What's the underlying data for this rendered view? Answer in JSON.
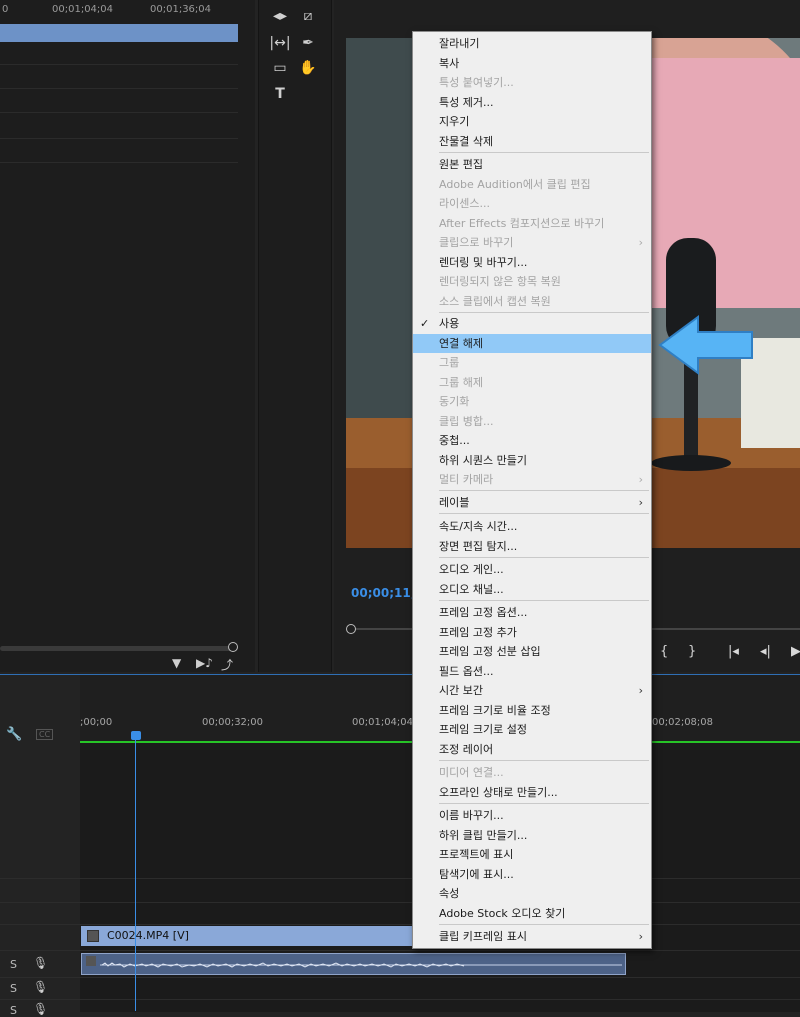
{
  "source_panel": {
    "timecodes": [
      "0",
      "00;01;04;04",
      "00;01;36;04"
    ]
  },
  "program_panel": {
    "timecode": "00;00;11;5"
  },
  "timeline": {
    "ruler": [
      ";00;00",
      "00;00;32;00",
      "00;01;04;04",
      "00;02;08;08"
    ],
    "video_clip_name": "C0024.MP4 [V]",
    "track_label_s": "S",
    "cc_label": "CC"
  },
  "context_menu": {
    "items": [
      {
        "label": "잘라내기",
        "enabled": true
      },
      {
        "label": "복사",
        "enabled": true
      },
      {
        "label": "특성 붙여넣기...",
        "enabled": false
      },
      {
        "label": "특성 제거...",
        "enabled": true
      },
      {
        "label": "지우기",
        "enabled": true
      },
      {
        "label": "잔물결 삭제",
        "enabled": true
      },
      {
        "label": "원본 편집",
        "enabled": true
      },
      {
        "label": "Adobe Audition에서 클립 편집",
        "enabled": false
      },
      {
        "label": "라이센스...",
        "enabled": false
      },
      {
        "label": "After Effects 컴포지션으로 바꾸기",
        "enabled": false
      },
      {
        "label": "클립으로 바꾸기",
        "enabled": false
      },
      {
        "label": "렌더링 및 바꾸기...",
        "enabled": true
      },
      {
        "label": "렌더링되지 않은 항목 복원",
        "enabled": false
      },
      {
        "label": "소스 클립에서 캡션 복원",
        "enabled": false
      },
      {
        "label": "사용",
        "enabled": true
      },
      {
        "label": "연결 해제",
        "enabled": true
      },
      {
        "label": "그룹",
        "enabled": false
      },
      {
        "label": "그룹 해제",
        "enabled": false
      },
      {
        "label": "동기화",
        "enabled": false
      },
      {
        "label": "클립 병합...",
        "enabled": false
      },
      {
        "label": "중첩...",
        "enabled": true
      },
      {
        "label": "하위 시퀀스 만들기",
        "enabled": true
      },
      {
        "label": "멀티 카메라",
        "enabled": false
      },
      {
        "label": "레이블",
        "enabled": true
      },
      {
        "label": "속도/지속 시간...",
        "enabled": true
      },
      {
        "label": "장면 편집 탐지...",
        "enabled": true
      },
      {
        "label": "오디오 게인...",
        "enabled": true
      },
      {
        "label": "오디오 채널...",
        "enabled": true
      },
      {
        "label": "프레임 고정 옵션...",
        "enabled": true
      },
      {
        "label": "프레임 고정 추가",
        "enabled": true
      },
      {
        "label": "프레임 고정 선분 삽입",
        "enabled": true
      },
      {
        "label": "필드 옵션...",
        "enabled": true
      },
      {
        "label": "시간 보간",
        "enabled": true
      },
      {
        "label": "프레임 크기로 비율 조정",
        "enabled": true
      },
      {
        "label": "프레임 크기로 설정",
        "enabled": true
      },
      {
        "label": "조정 레이어",
        "enabled": true
      },
      {
        "label": "미디어 연결...",
        "enabled": false
      },
      {
        "label": "오프라인 상태로 만들기...",
        "enabled": true
      },
      {
        "label": "이름 바꾸기...",
        "enabled": true
      },
      {
        "label": "하위 클립 만들기...",
        "enabled": true
      },
      {
        "label": "프로젝트에 표시",
        "enabled": true
      },
      {
        "label": "탐색기에 표시...",
        "enabled": true
      },
      {
        "label": "속성",
        "enabled": true
      },
      {
        "label": "Adobe Stock 오디오 찾기",
        "enabled": true
      },
      {
        "label": "클립 키프레임 표시",
        "enabled": true
      }
    ],
    "checked": "사용",
    "highlighted": "연결 해제",
    "submenu_arrow": "›",
    "check_mark": "✓"
  },
  "colors": {
    "accent_blue": "#3a8ee6",
    "menu_highlight": "#91c9f7",
    "callout_arrow": "#57b4f5",
    "clip_video": "#8aa8d8",
    "clip_audio": "#4d6287",
    "green_bar": "#27c427"
  }
}
